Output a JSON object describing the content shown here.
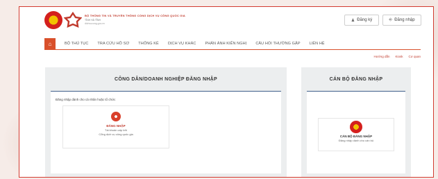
{
  "header": {
    "org_line1": "BỘ THÔNG TIN VÀ TRUYỀN THÔNG CỔNG DỊCH VỤ CÔNG QUỐC GIA",
    "org_line2": "TỈNH HÀ TĨNH",
    "org_line3": "dichvucong.gov.vn",
    "register_label": "Đăng ký",
    "login_label": "Đăng nhập"
  },
  "nav": {
    "home_icon": "home-icon",
    "items": [
      "BỘ THỦ TỤC",
      "TRA CỨU HỒ SƠ",
      "THỐNG KÊ",
      "DỊCH VỤ KHÁC",
      "PHẢN ÁNH KIẾN NGHỊ",
      "CÂU HỎI THƯỜNG GẶP",
      "LIÊN HỆ"
    ]
  },
  "subbar": {
    "guide": "Hướng dẫn",
    "kiosk": "Kiosk",
    "agency": "Cơ quan"
  },
  "citizen_panel": {
    "title": "CÔNG DÂN/DOANH NGHIỆP ĐĂNG NHẬP",
    "caption": "Đăng nhập dành cho cá nhân hoặc tổ chức",
    "card_title": "ĐĂNG NHẬP",
    "card_sub1": "Tài khoản cấp bởi",
    "card_sub2": "Cổng dịch vụ công quốc gia"
  },
  "staff_panel": {
    "title": "CÁN BỘ ĐĂNG NHẬP",
    "card_title": "CÁN BỘ ĐĂNG NHẬP",
    "card_sub": "Đăng nhập dành cho cán bộ"
  },
  "colors": {
    "accent": "#d9502b",
    "frame_border": "#d33a2f",
    "panel_underline": "#3f5f8a"
  }
}
